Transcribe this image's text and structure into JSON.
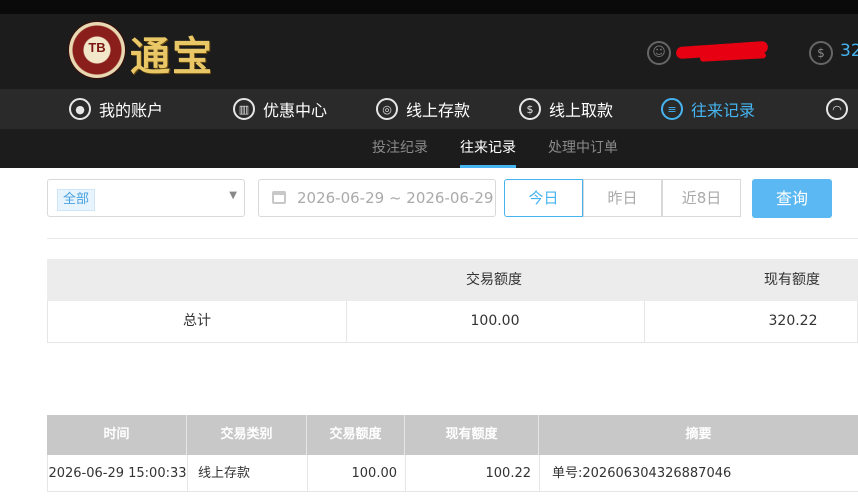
{
  "brand": {
    "badge": "TB",
    "name": "通宝"
  },
  "header": {
    "balance": "32"
  },
  "nav": [
    {
      "label": "我的账户",
      "icon": "user-icon"
    },
    {
      "label": "优惠中心",
      "icon": "gift-icon"
    },
    {
      "label": "线上存款",
      "icon": "deposit-icon"
    },
    {
      "label": "线上取款",
      "icon": "withdraw-icon"
    },
    {
      "label": "往来记录",
      "icon": "records-icon"
    },
    {
      "label": "",
      "icon": "bell-icon"
    }
  ],
  "subnav": [
    "投注纪录",
    "往来记录",
    "处理中订单"
  ],
  "filter": {
    "type_tag": "全部",
    "date_range": "2026-06-29 ~ 2026-06-29",
    "quick": [
      "今日",
      "昨日",
      "近8日"
    ],
    "search_label": "查询"
  },
  "summary": {
    "headers": [
      "",
      "交易额度",
      "现有额度"
    ],
    "row": [
      "总计",
      "100.00",
      "320.22"
    ]
  },
  "records": {
    "headers": [
      "时间",
      "交易类别",
      "交易额度",
      "现有额度",
      "摘要"
    ],
    "rows": [
      [
        "2026-06-29 15:00:33",
        "线上存款",
        "100.00",
        "100.22",
        "单号:202606304326887046"
      ]
    ]
  },
  "colors": {
    "accent": "#46b4f0",
    "brand_gold": "#e9c766",
    "header_bg": "#1c1c1c"
  }
}
